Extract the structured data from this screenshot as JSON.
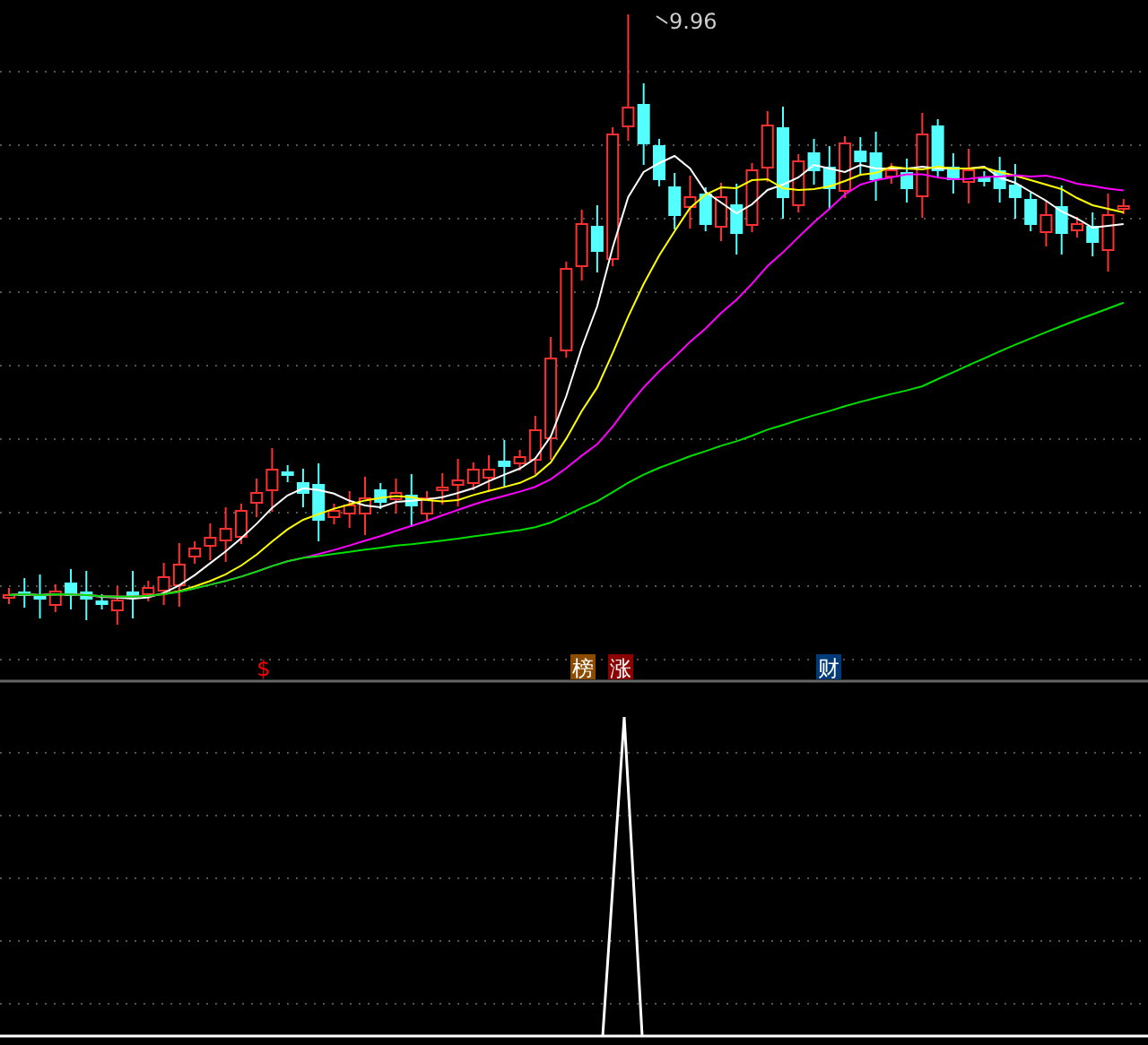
{
  "price_chart": {
    "peak_price_label": "9.96"
  },
  "signals": [
    {
      "text": "$",
      "kind": "glyph",
      "color": "#ff0000"
    },
    {
      "text": "榜",
      "kind": "tag",
      "color": "#8b4c00"
    },
    {
      "text": "涨",
      "kind": "tag",
      "color": "#8b0000"
    },
    {
      "text": "财",
      "kind": "tag",
      "color": "#003a7a"
    }
  ]
}
